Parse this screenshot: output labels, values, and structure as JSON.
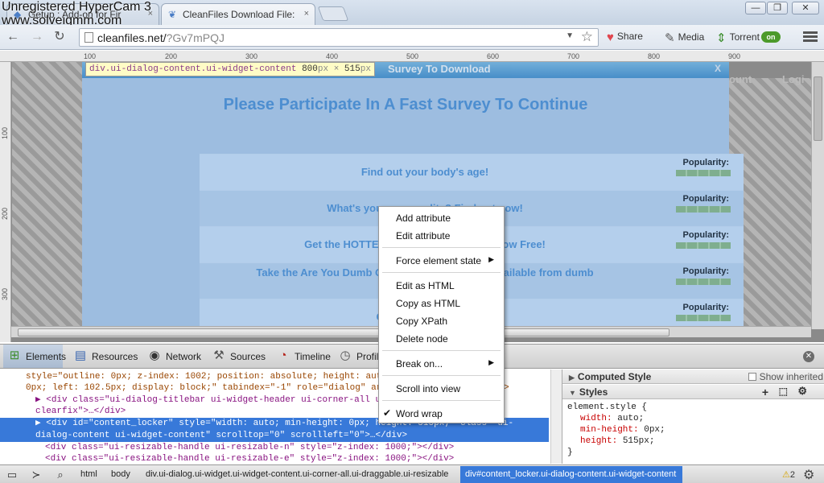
{
  "overlay": {
    "line1": "Unregistered HyperCam 3",
    "line2": "www.solveigmm.com"
  },
  "tabs": [
    {
      "label": "Getup : Add-on for Fir",
      "close": "×"
    },
    {
      "label": "CleanFiles Download File:",
      "close": "×"
    }
  ],
  "window_controls": {
    "minimize": "—",
    "maximize": "❐",
    "close": "✕"
  },
  "toolbar": {
    "back": "←",
    "forward": "→",
    "reload": "↻",
    "url_host": "cleanfiles.net/",
    "url_path": "?Gv7mPQJ",
    "star": "☆",
    "share_label": "Share",
    "media_label": "Media",
    "torrent_label": "Torrent",
    "torrent_state": "on"
  },
  "rulers": {
    "top": [
      "100",
      "200",
      "300",
      "400",
      "500",
      "600",
      "700",
      "800",
      "900"
    ],
    "left": [
      "100",
      "200",
      "300"
    ]
  },
  "inspect_tooltip": {
    "selector": "div.ui-dialog-content.ui-widget-content",
    "w": "800",
    "h": "515",
    "unit": "px",
    "sep": "×"
  },
  "page": {
    "dialog_title": "Survey To Download",
    "dialog_close": "X",
    "headline": "Please Participate In A Fast Survey To Continue",
    "right_links": [
      "ount",
      "Logi"
    ],
    "popularity_label": "Popularity:",
    "offers": [
      {
        "text": "Find out your body's age!"
      },
      {
        "text": "What's your personality? Find out now!"
      },
      {
        "text": "Get the HOTTEST Ringtones available now Free!"
      },
      {
        "text": "Take the Are You Dumb Quiz! Latest Ringtones available from dumb"
      },
      {
        "text": "Get Top Downloads"
      }
    ]
  },
  "devtools": {
    "tabs": [
      {
        "label": "Elements",
        "icon": "elements-icon"
      },
      {
        "label": "Resources",
        "icon": "resources-icon"
      },
      {
        "label": "Network",
        "icon": "network-icon"
      },
      {
        "label": "Sources",
        "icon": "sources-icon"
      },
      {
        "label": "Timeline",
        "icon": "timeline-icon"
      },
      {
        "label": "Profiles",
        "icon": "profiles-icon"
      }
    ],
    "dom_lines": [
      {
        "t": "style=\"outline: 0px; z-index: 1002; position: absolute; height: auto; width: 800px; top:"
      },
      {
        "t": "0px; left: 102.5px; display: block;\" tabindex=\"-1\" role=\"dialog\" aria-labelledby=\"ui-id-1\">"
      },
      {
        "t": "clearfix\">…</div>"
      },
      {
        "t": "▶ <div class=\"ui-dialog-titlebar ui-widget-header ui-corner-all ui-helper-"
      },
      {
        "t": "▶ <div id=\"content_locker\" style=\"width: auto; min-height: 0px; height: 515px;\" class=\"ui-"
      },
      {
        "t": "dialog-content ui-widget-content\" scrolltop=\"0\" scrollleft=\"0\">…</div>"
      },
      {
        "t": "<div class=\"ui-resizable-handle ui-resizable-n\" style=\"z-index: 1000;\"></div>"
      },
      {
        "t": "<div class=\"ui-resizable-handle ui-resizable-e\" style=\"z-index: 1000;\"></div>"
      }
    ],
    "computed_style": "Computed Style",
    "show_inherited": "Show inherited",
    "styles": "Styles",
    "style_selector": "element.style {",
    "style_props": [
      {
        "p": "width",
        "v": "auto;"
      },
      {
        "p": "min-height",
        "v": "0px;"
      },
      {
        "p": "height",
        "v": "515px;"
      }
    ],
    "style_close": "}",
    "breadcrumbs": [
      "html",
      "body",
      "div.ui-dialog.ui-widget.ui-widget-content.ui-corner-all.ui-draggable.ui-resizable"
    ],
    "breadcrumb_active": "div#content_locker.ui-dialog-content.ui-widget-content",
    "warnings": "2"
  },
  "context_menu": {
    "items": [
      {
        "label": "Add attribute"
      },
      {
        "label": "Edit attribute"
      },
      {
        "label": "Force element state"
      },
      {
        "label": "Edit as HTML"
      },
      {
        "label": "Copy as HTML"
      },
      {
        "label": "Copy XPath"
      },
      {
        "label": "Delete node"
      },
      {
        "label": "Break on..."
      },
      {
        "label": "Scroll into view"
      },
      {
        "label": "Word wrap"
      }
    ],
    "submenu_arrow": "▶",
    "check": "✔"
  }
}
